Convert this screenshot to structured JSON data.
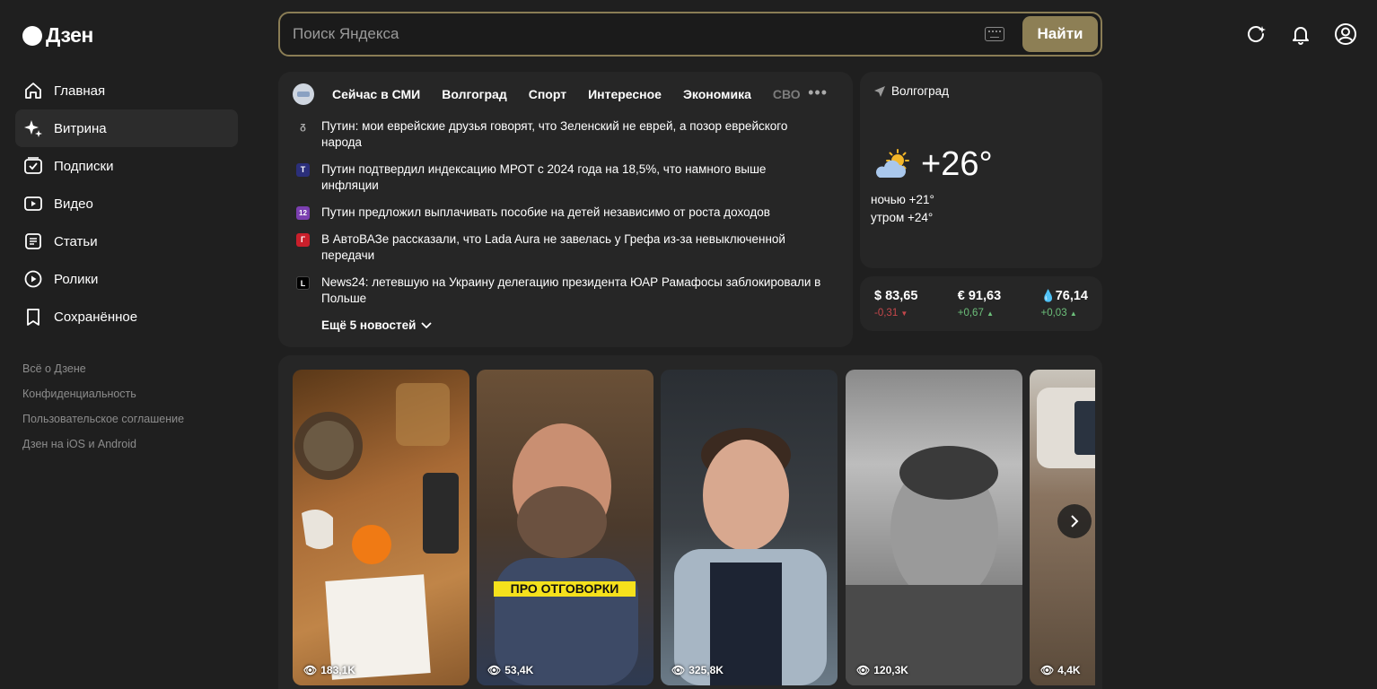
{
  "header": {
    "logo_text": "Дзен",
    "search_placeholder": "Поиск Яндекса",
    "search_button": "Найти"
  },
  "top_icons": [
    "refresh-sparkle-icon",
    "bell-icon",
    "profile-icon"
  ],
  "sidebar": {
    "items": [
      {
        "label": "Главная",
        "icon": "home-icon"
      },
      {
        "label": "Витрина",
        "icon": "sparkle-icon",
        "active": true
      },
      {
        "label": "Подписки",
        "icon": "subscriptions-icon"
      },
      {
        "label": "Видео",
        "icon": "video-icon"
      },
      {
        "label": "Статьи",
        "icon": "article-icon"
      },
      {
        "label": "Ролики",
        "icon": "shorts-icon"
      },
      {
        "label": "Сохранённое",
        "icon": "bookmark-icon"
      }
    ],
    "footer_links": [
      "Всё о Дзене",
      "Конфиденциальность",
      "Пользовательское соглашение",
      "Дзен на iOS и Android"
    ]
  },
  "news": {
    "tabs": [
      "Сейчас в СМИ",
      "Волгоград",
      "Спорт",
      "Интересное",
      "Экономика",
      "СВО"
    ],
    "items": [
      {
        "text": "Путин: мои еврейские друзья говорят, что Зеленский не еврей, а позор еврейского народа",
        "src_color": "#262626",
        "src_letter": "ᵹ"
      },
      {
        "text": "Путин подтвердил индексацию МРОТ с 2024 года на 18,5%, что намного выше инфляции",
        "src_color": "#2b2f7a",
        "src_letter": "T"
      },
      {
        "text": "Путин предложил выплачивать пособие на детей независимо от роста доходов",
        "src_color": "#7b3fb0",
        "src_letter": "12"
      },
      {
        "text": "В АвтоВАЗе рассказали, что Lada Aura не завелась у Грефа из-за невыключенной передачи",
        "src_color": "#c91f2b",
        "src_letter": "Г"
      },
      {
        "text": "News24: летевшую на Украину делегацию президента ЮАР Рамафосы заблокировали в Польше",
        "src_color": "#000000",
        "src_letter": "L"
      }
    ],
    "more_label": "Ещё 5 новостей"
  },
  "weather": {
    "city": "Волгоград",
    "temp": "+26°",
    "night": "ночью +21°",
    "morning": "утром +24°"
  },
  "rates": [
    {
      "value": "$ 83,65",
      "change": "-0,31",
      "direction": "down"
    },
    {
      "value": "€ 91,63",
      "change": "+0,67",
      "direction": "up"
    },
    {
      "value": "76,14",
      "change": "+0,03",
      "direction": "up",
      "icon": "oil-drop-icon"
    }
  ],
  "videos": [
    {
      "views": "183,1K",
      "palette": [
        "#7a4a22",
        "#a86a35",
        "#c08548"
      ]
    },
    {
      "views": "53,4K",
      "caption": "ПРО ОТГОВОРКИ",
      "palette": [
        "#4b3a2c",
        "#6b5440",
        "#2e3a52"
      ]
    },
    {
      "views": "325,8K",
      "palette": [
        "#3a3f44",
        "#6b7b88",
        "#a7b6c4"
      ]
    },
    {
      "views": "120,3K",
      "palette": [
        "#2a2a2a",
        "#6a6a6a",
        "#bdbdbd"
      ]
    },
    {
      "views": "4,4K",
      "palette": [
        "#5a4a3a",
        "#8a7460",
        "#c9b9a4"
      ]
    }
  ]
}
